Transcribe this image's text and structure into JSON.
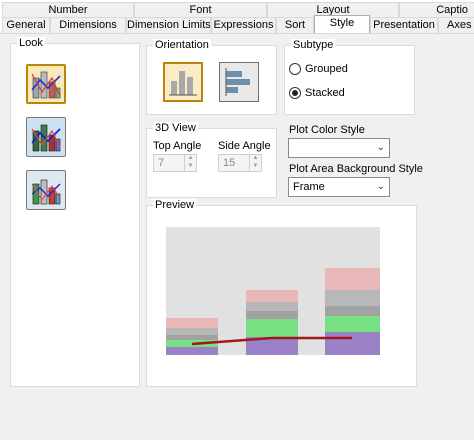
{
  "tabs_row1": [
    {
      "label": "Number"
    },
    {
      "label": "Font"
    },
    {
      "label": "Layout"
    },
    {
      "label": "Captio"
    }
  ],
  "tabs_row2": [
    {
      "label": "General"
    },
    {
      "label": "Dimensions"
    },
    {
      "label": "Dimension Limits"
    },
    {
      "label": "Expressions"
    },
    {
      "label": "Sort"
    },
    {
      "label": "Style"
    },
    {
      "label": "Presentation"
    },
    {
      "label": "Axes"
    }
  ],
  "active_tab": "Style",
  "look": {
    "title": "Look",
    "options": [
      {
        "icon": "chart-look-style-1-icon",
        "selected": true
      },
      {
        "icon": "chart-look-style-2-icon",
        "selected": false
      },
      {
        "icon": "chart-look-style-3-icon",
        "selected": false
      }
    ]
  },
  "orientation": {
    "title": "Orientation",
    "options": [
      {
        "icon": "vertical-bars-icon",
        "selected": true
      },
      {
        "icon": "horizontal-bars-icon",
        "selected": false
      }
    ]
  },
  "subtype": {
    "title": "Subtype",
    "options": [
      {
        "label": "Grouped",
        "checked": false
      },
      {
        "label": "Stacked",
        "checked": true
      }
    ]
  },
  "view3d": {
    "title": "3D View",
    "top_angle_label": "Top Angle",
    "top_angle_value": "7",
    "side_angle_label": "Side Angle",
    "side_angle_value": "15"
  },
  "plot_color_style": {
    "label": "Plot Color Style",
    "value": ""
  },
  "plot_area_bg_style": {
    "label": "Plot Area Background Style",
    "value": "Frame"
  },
  "preview": {
    "title": "Preview"
  },
  "colors": {
    "panel_bg": "#f0f0f0",
    "group_bg": "#ffffff",
    "selected_border": "#b8860b",
    "preview_bg": "#e1e1e1",
    "line_color": "#a01818"
  }
}
